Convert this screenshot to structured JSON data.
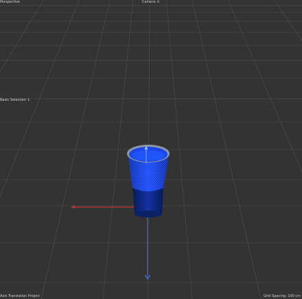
{
  "viewport": {
    "view_mode": "Perspective",
    "camera": "Camera ⊙",
    "selection_mode": "Basic Selection ↕",
    "footer_left": "Axis Translation Project",
    "footer_right": "Grid Spacing: 100 cm"
  },
  "colors": {
    "background": "#333333",
    "grid_line": "#4a4a4a",
    "x_axis": "#c0392b",
    "z_axis": "#3f6fd8",
    "object_fill": "#1a47e8",
    "object_rim": "#9aa4b5",
    "object_shadow": "#0e2a6e"
  },
  "object": {
    "name": "cup",
    "selected": true
  }
}
